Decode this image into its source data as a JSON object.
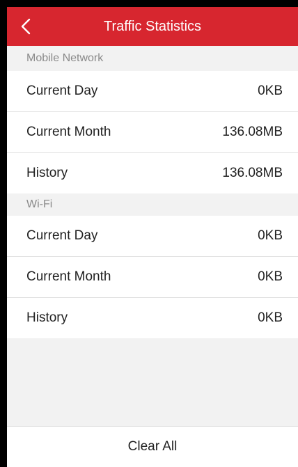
{
  "header": {
    "title": "Traffic Statistics",
    "back_icon": "chevron-left-icon",
    "color": "#d7262f"
  },
  "mobile_network": {
    "label": "Mobile Network",
    "rows": [
      {
        "label": "Current Day",
        "value": "0KB"
      },
      {
        "label": "Current Month",
        "value": "136.08MB"
      },
      {
        "label": "History",
        "value": "136.08MB"
      }
    ]
  },
  "wifi": {
    "label": "Wi-Fi",
    "rows": [
      {
        "label": "Current Day",
        "value": "0KB"
      },
      {
        "label": "Current Month",
        "value": "0KB"
      },
      {
        "label": "History",
        "value": "0KB"
      }
    ]
  },
  "footer": {
    "clear_all_label": "Clear All"
  }
}
